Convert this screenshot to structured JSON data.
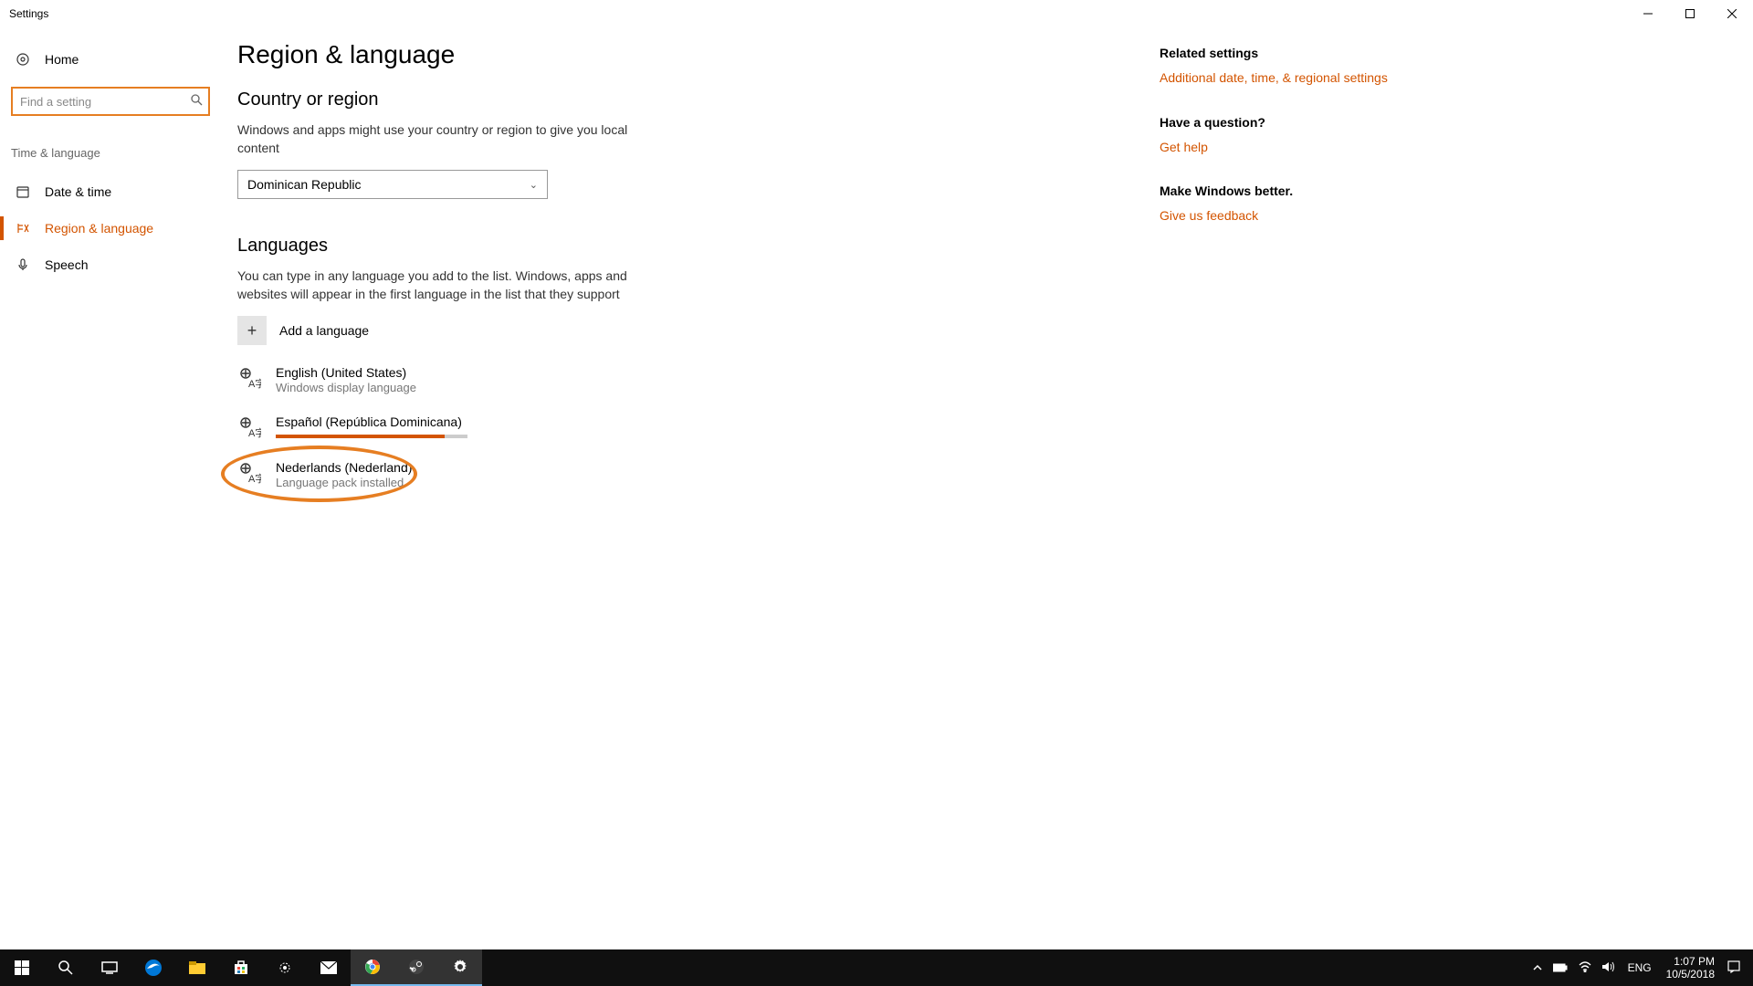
{
  "window": {
    "title": "Settings"
  },
  "sidebar": {
    "home": "Home",
    "search_placeholder": "Find a setting",
    "category": "Time & language",
    "items": [
      {
        "label": "Date & time"
      },
      {
        "label": "Region & language"
      },
      {
        "label": "Speech"
      }
    ]
  },
  "page": {
    "title": "Region & language",
    "region_section": "Country or region",
    "region_desc": "Windows and apps might use your country or region to give you local content",
    "region_value": "Dominican Republic",
    "lang_section": "Languages",
    "lang_desc": "You can type in any language you add to the list. Windows, apps and websites will appear in the first language in the list that they support",
    "add_language": "Add a language",
    "languages": [
      {
        "name": "English (United States)",
        "sub": "Windows display language"
      },
      {
        "name": "Español (República Dominicana)",
        "progress": 88
      },
      {
        "name": "Nederlands (Nederland)",
        "sub": "Language pack installed"
      }
    ]
  },
  "right": {
    "related_heading": "Related settings",
    "related_link": "Additional date, time, & regional settings",
    "question_heading": "Have a question?",
    "question_link": "Get help",
    "better_heading": "Make Windows better.",
    "better_link": "Give us feedback"
  },
  "taskbar": {
    "lang": "ENG",
    "time": "1:07 PM",
    "date": "10/5/2018"
  }
}
